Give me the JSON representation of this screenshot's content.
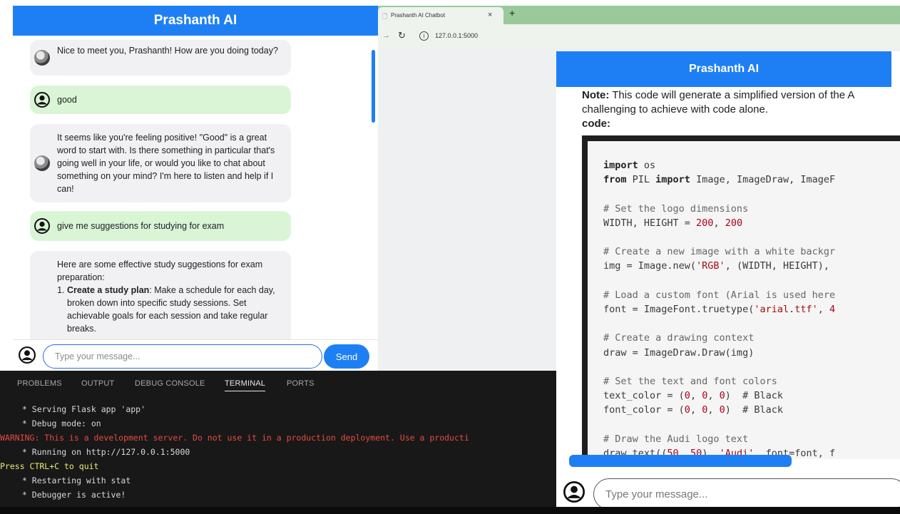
{
  "left_chat": {
    "title": "Prashanth AI",
    "messages": [
      {
        "role": "bot",
        "text": "Nice to meet you, Prashanth! How are you doing today?"
      },
      {
        "role": "user",
        "text": "good"
      },
      {
        "role": "bot",
        "text": "It seems like you're feeling positive! \"Good\" is a great word to start with. Is there something in particular that's going well in your life, or would you like to chat about something on your mind? I'm here to listen and help if I can!"
      },
      {
        "role": "user",
        "text": "give me suggestions for studying for exam"
      },
      {
        "role": "bot",
        "intro": "Here are some effective study suggestions for exam preparation:",
        "item_title": "Create a study plan",
        "item_text": ": Make a schedule for each day, broken down into specific study sessions. Set achievable goals for each session and take regular breaks."
      }
    ],
    "input_placeholder": "Type your message...",
    "send_label": "Send"
  },
  "browser": {
    "tab_title": "Prashanth AI Chatbot",
    "tab_close": "×",
    "new_tab": "+",
    "address": "127.0.0.1:5000",
    "right_chat": {
      "title": "Prashanth AI",
      "note_label": "Note:",
      "note_text": " This code will generate a simplified version of the A",
      "note_text2": "challenging to achieve with code alone.",
      "code_label": "code:",
      "code_lines": [
        "import os",
        "from PIL import Image, ImageDraw, ImageF",
        "",
        "# Set the logo dimensions",
        "WIDTH, HEIGHT = 200, 200",
        "",
        "# Create a new image with a white backgr",
        "img = Image.new('RGB', (WIDTH, HEIGHT),",
        "",
        "# Load a custom font (Arial is used here",
        "font = ImageFont.truetype('arial.ttf', 4",
        "",
        "# Create a drawing context",
        "draw = ImageDraw.Draw(img)",
        "",
        "# Set the text and font colors",
        "text_color = (0, 0, 0)  # Black",
        "font_color = (0, 0, 0)  # Black",
        "",
        "# Draw the Audi logo text",
        "draw.text((50, 50), 'Audi', font=font, f"
      ],
      "input_placeholder": "Type your message..."
    }
  },
  "terminal": {
    "tabs": [
      "PROBLEMS",
      "OUTPUT",
      "DEBUG CONSOLE",
      "TERMINAL",
      "PORTS"
    ],
    "active_tab": "TERMINAL",
    "lines": [
      {
        "kind": "normal",
        "text": " * Serving Flask app 'app'"
      },
      {
        "kind": "normal",
        "text": " * Debug mode: on"
      },
      {
        "kind": "warn",
        "text": "WARNING: This is a development server. Do not use it in a production deployment. Use a producti"
      },
      {
        "kind": "normal",
        "text": " * Running on http://127.0.0.1:5000"
      },
      {
        "kind": "press",
        "text": "Press CTRL+C to quit"
      },
      {
        "kind": "normal",
        "text": " * Restarting with stat"
      },
      {
        "kind": "normal",
        "text": " * Debugger is active!"
      }
    ]
  },
  "colors": {
    "accent_blue": "#1e7ff5",
    "user_bubble": "#d9f5d6",
    "bot_bubble": "#f1f1f4",
    "terminal_bg": "#181818",
    "terminal_warning": "#e64a45",
    "terminal_press": "#eaea7a"
  }
}
